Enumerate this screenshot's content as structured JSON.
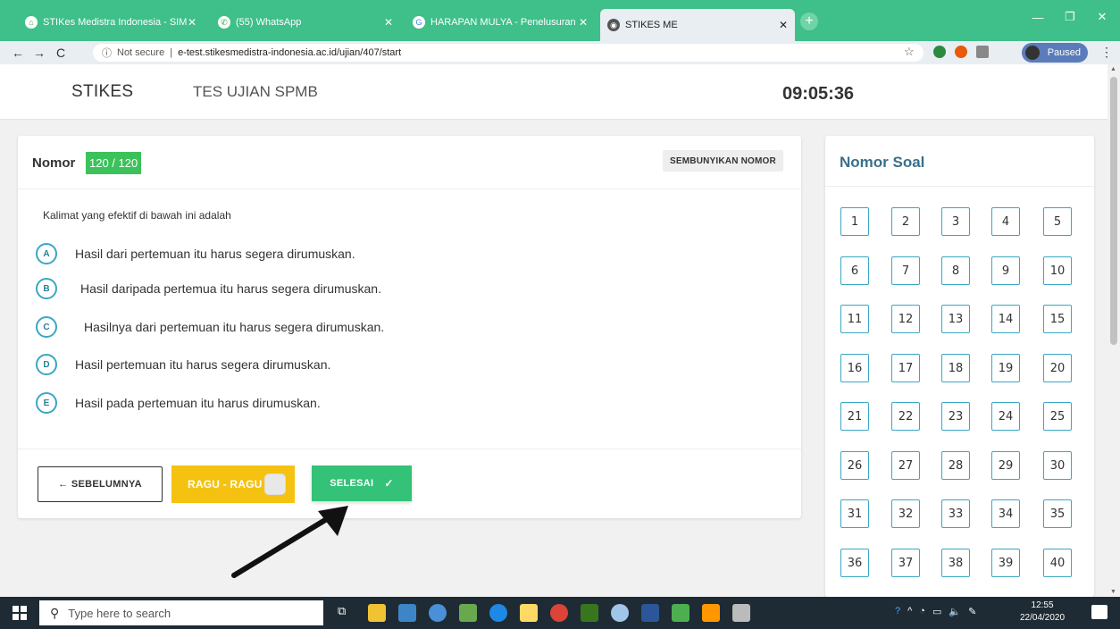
{
  "browser": {
    "tabs": [
      {
        "title": "STIKes Medistra Indonesia - SIM",
        "icon": "school-icon",
        "active": false
      },
      {
        "title": "(55) WhatsApp",
        "icon": "whatsapp-icon",
        "active": false
      },
      {
        "title": "HARAPAN MULYA - Penelusuran",
        "icon": "google-icon",
        "active": false
      },
      {
        "title": "STIKES ME",
        "icon": "globe-icon",
        "active": true
      }
    ],
    "address": {
      "security": "Not secure",
      "url": "e-test.stikesmedistra-indonesia.ac.id/ujian/407/start"
    },
    "profile_status": "Paused",
    "colors": {
      "tabbar": "#3fbf8a"
    }
  },
  "header": {
    "brand": "STIKES",
    "subtitle": "TES UJIAN SPMB",
    "timer": "09:05:36"
  },
  "question": {
    "nomor_label": "Nomor",
    "nomor_value": "120 / 120",
    "hide_button": "SEMBUNYIKAN NOMOR",
    "text": "Kalimat yang efektif di bawah ini adalah",
    "options": [
      {
        "letter": "A",
        "text": "Hasil dari pertemuan itu harus segera dirumuskan."
      },
      {
        "letter": "B",
        "text": "Hasil daripada pertemua itu harus segera dirumuskan."
      },
      {
        "letter": "C",
        "text": "Hasilnya dari pertemuan itu harus segera dirumuskan."
      },
      {
        "letter": "D",
        "text": "Hasil pertemuan itu harus segera dirumuskan."
      },
      {
        "letter": "E",
        "text": "Hasil pada pertemuan itu harus dirumuskan."
      }
    ],
    "prev_button": "← SEBELUMNYA",
    "ragu_button": "RAGU - RAGU",
    "selesai_button": "SELESAI",
    "colors": {
      "accent": "#33c277",
      "ragu": "#f5c211",
      "badge": "#3cc25a"
    }
  },
  "panel": {
    "title": "Nomor Soal",
    "numbers": [
      "1",
      "2",
      "3",
      "4",
      "5",
      "6",
      "7",
      "8",
      "9",
      "10",
      "11",
      "12",
      "13",
      "14",
      "15",
      "16",
      "17",
      "18",
      "19",
      "20",
      "21",
      "22",
      "23",
      "24",
      "25",
      "26",
      "27",
      "28",
      "29",
      "30",
      "31",
      "32",
      "33",
      "34",
      "35",
      "36",
      "37",
      "38",
      "39",
      "40"
    ]
  },
  "taskbar": {
    "search_placeholder": "Type here to search",
    "time": "12:55",
    "date": "22/04/2020"
  }
}
